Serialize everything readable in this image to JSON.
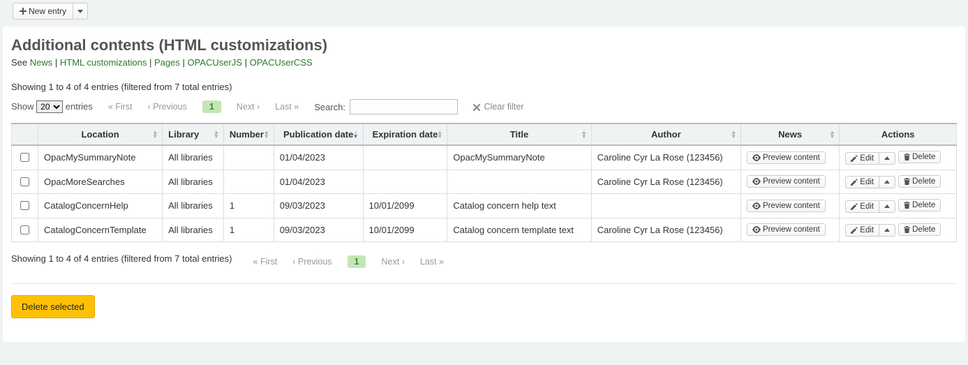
{
  "toolbar": {
    "new_entry_label": "New entry"
  },
  "page": {
    "title": "Additional contents (HTML customizations)",
    "see_prefix": "See ",
    "links": {
      "news": "News",
      "html_customizations": "HTML customizations",
      "pages": "Pages",
      "opacuserjs": "OPACUserJS",
      "opacusercss": "OPACUserCSS"
    },
    "sep": " | "
  },
  "datatable": {
    "info_top": "Showing 1 to 4 of 4 entries (filtered from 7 total entries)",
    "info_bottom": "Showing 1 to 4 of 4 entries (filtered from 7 total entries)",
    "show_label": "Show",
    "entries_label": "entries",
    "entries_value": "20",
    "pager": {
      "first": "First",
      "previous": "Previous",
      "current": "1",
      "next": "Next",
      "last": "Last"
    },
    "search_label": "Search:",
    "search_value": "",
    "clear_filter": "Clear filter",
    "columns": {
      "location": "Location",
      "library": "Library",
      "number": "Number",
      "publication_date": "Publication date",
      "expiration_date": "Expiration date",
      "title": "Title",
      "author": "Author",
      "news": "News",
      "actions": "Actions"
    },
    "rows": [
      {
        "location": "OpacMySummaryNote",
        "library": "All libraries",
        "number": "",
        "publication_date": "01/04/2023",
        "expiration_date": "",
        "title": "OpacMySummaryNote",
        "author": "Caroline Cyr La Rose (123456)"
      },
      {
        "location": "OpacMoreSearches",
        "library": "All libraries",
        "number": "",
        "publication_date": "01/04/2023",
        "expiration_date": "",
        "title": "",
        "author": "Caroline Cyr La Rose (123456)"
      },
      {
        "location": "CatalogConcernHelp",
        "library": "All libraries",
        "number": "1",
        "publication_date": "09/03/2023",
        "expiration_date": "10/01/2099",
        "title": "Catalog concern help text",
        "author": ""
      },
      {
        "location": "CatalogConcernTemplate",
        "library": "All libraries",
        "number": "1",
        "publication_date": "09/03/2023",
        "expiration_date": "10/01/2099",
        "title": "Catalog concern template text",
        "author": "Caroline Cyr La Rose (123456)"
      }
    ],
    "actions": {
      "preview_content": "Preview content",
      "edit": "Edit",
      "delete": "Delete"
    }
  },
  "footer": {
    "delete_selected": "Delete selected"
  }
}
